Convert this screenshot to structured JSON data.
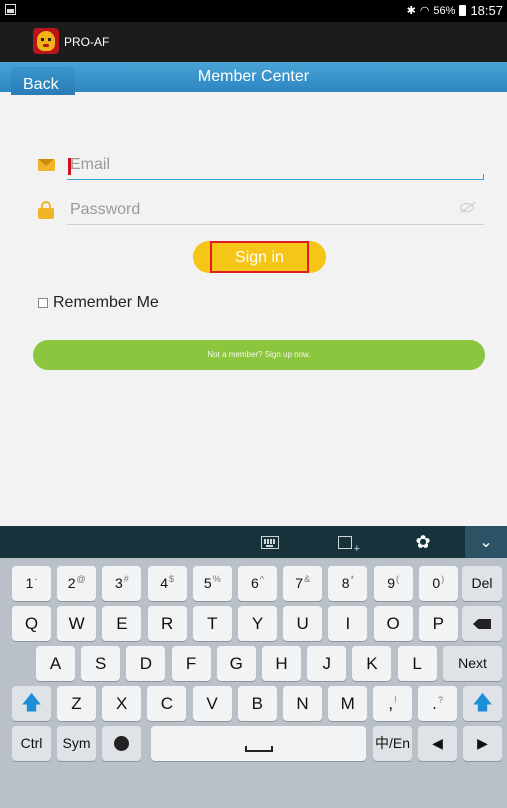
{
  "status_bar": {
    "battery": "56%",
    "time": "18:57"
  },
  "app": {
    "name": "PRO-AF"
  },
  "nav": {
    "back_label": "Back",
    "title": "Member Center"
  },
  "form": {
    "email_placeholder": "Email",
    "password_placeholder": "Password",
    "signin_label": "Sign in",
    "remember_label": "Remember Me",
    "signup_label": "Not a member? Sign up now."
  },
  "keyboard": {
    "row1": [
      {
        "k": "1",
        "s": "-"
      },
      {
        "k": "2",
        "s": "@"
      },
      {
        "k": "3",
        "s": "#"
      },
      {
        "k": "4",
        "s": "$"
      },
      {
        "k": "5",
        "s": "%"
      },
      {
        "k": "6",
        "s": "^"
      },
      {
        "k": "7",
        "s": "&"
      },
      {
        "k": "8",
        "s": "*"
      },
      {
        "k": "9",
        "s": "("
      },
      {
        "k": "0",
        "s": ")"
      }
    ],
    "row2": [
      "Q",
      "W",
      "E",
      "R",
      "T",
      "Y",
      "U",
      "I",
      "O",
      "P"
    ],
    "row3": [
      "A",
      "S",
      "D",
      "F",
      "G",
      "H",
      "J",
      "K",
      "L"
    ],
    "row4": [
      "Z",
      "X",
      "C",
      "V",
      "B",
      "N",
      "M"
    ],
    "del_label": "Del",
    "next_label": "Next",
    "ctrl_label": "Ctrl",
    "sym_label": "Sym",
    "lang_label": "中/En",
    "comma_label": ",",
    "comma_alt": "!",
    "period_label": ".",
    "period_alt": "?"
  },
  "icons": {
    "email": "envelope-icon",
    "password": "lock-icon",
    "visibility": "eye-icon",
    "keyboard": "keyboard-icon",
    "clipboard": "clipboard-icon",
    "settings": "gear-icon",
    "hide_keyboard": "chevron-down-icon",
    "backspace": "backspace-icon",
    "shift": "shift-arrow-icon",
    "emoji": "emoji-icon",
    "space": "space-icon",
    "left": "left-arrow-icon",
    "right": "right-arrow-icon"
  },
  "colors": {
    "nav_blue": "#2d86c1",
    "signin_yellow": "#f5c518",
    "signup_green": "#8cc63f",
    "accent_red": "#e21b23"
  }
}
